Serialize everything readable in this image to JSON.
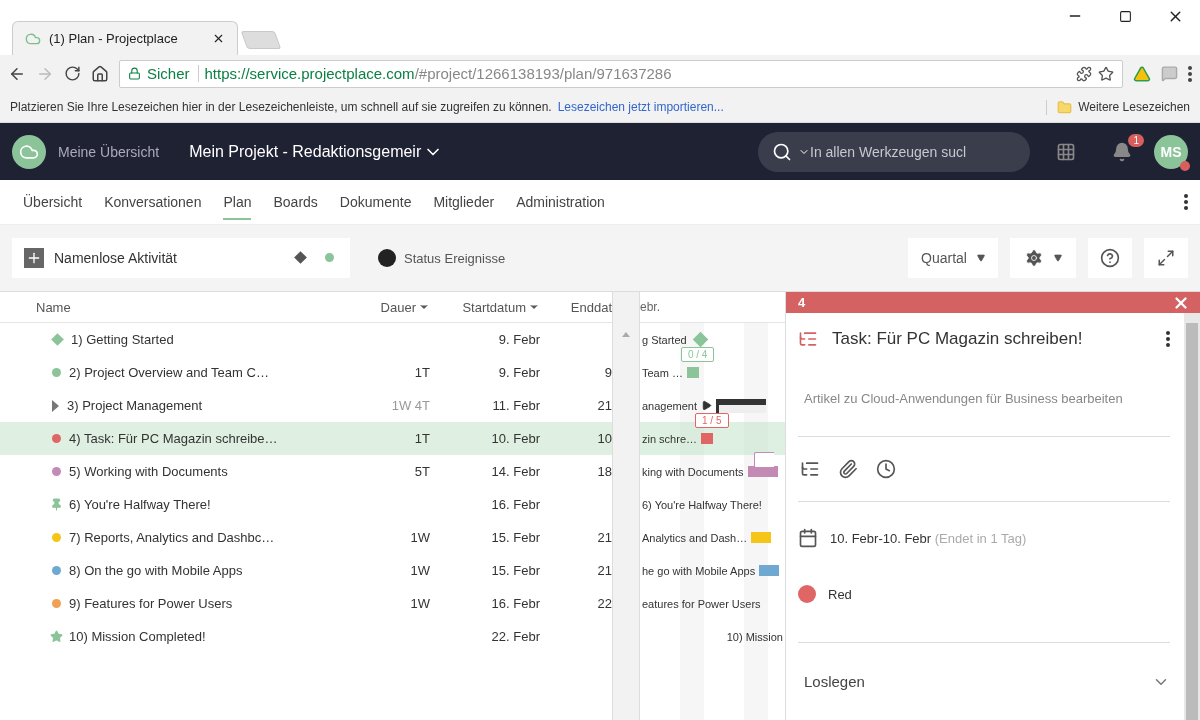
{
  "browser": {
    "tab_title": "(1) Plan - Projectplace",
    "secure_label": "Sicher",
    "url_host": "https://service.projectplace.com",
    "url_path": "/#project/1266138193/plan/971637286",
    "bookmarks_hint": "Platzieren Sie Ihre Lesezeichen hier in der Lesezeichenleiste, um schnell auf sie zugreifen zu können.",
    "bookmarks_link": "Lesezeichen jetzt importieren...",
    "bookmarks_folder": "Weitere Lesezeichen"
  },
  "header": {
    "home_label": "Meine Übersicht",
    "project": "Mein Projekt - Redaktionsgemeir",
    "search": {
      "placeholder": "In allen Werkzeugen sucl"
    },
    "notifications": "1",
    "avatar": "MS"
  },
  "nav_tabs": [
    {
      "label": "Übersicht",
      "selected": false
    },
    {
      "label": "Konversationen",
      "selected": false
    },
    {
      "label": "Plan",
      "selected": true
    },
    {
      "label": "Boards",
      "selected": false
    },
    {
      "label": "Dokumente",
      "selected": false
    },
    {
      "label": "Mitglieder",
      "selected": false
    },
    {
      "label": "Administration",
      "selected": false
    }
  ],
  "toolbar": {
    "new_activity": {
      "placeholder": "Namenlose Aktivität"
    },
    "status_label": "Status Ereignisse",
    "period": "Quartal"
  },
  "table": {
    "columns": [
      "Name",
      "Dauer",
      "Startdatum",
      "Enddat"
    ],
    "rows": [
      {
        "kind": "milestone",
        "color": "#8cc49a",
        "name": "1)  Getting Started",
        "duration": "",
        "start": "9. Febr",
        "end": "",
        "selected": false
      },
      {
        "kind": "task",
        "color": "#8cc49a",
        "name": "2)  Project Overview and Team C…",
        "duration": "1T",
        "start": "9. Febr",
        "end": "9",
        "selected": false
      },
      {
        "kind": "group",
        "color": "#777777",
        "name": "3)  Project Management",
        "duration": "1W 4T",
        "start": "11. Febr",
        "end": "21",
        "selected": false
      },
      {
        "kind": "task",
        "color": "#e06666",
        "name": "4)  Task: Für PC Magazin schreibe…",
        "duration": "1T",
        "start": "10. Febr",
        "end": "10",
        "selected": true
      },
      {
        "kind": "task",
        "color": "#c38ab5",
        "name": "5)  Working with Documents",
        "duration": "5T",
        "start": "14. Febr",
        "end": "18",
        "selected": false
      },
      {
        "kind": "pin",
        "color": "#8cc49a",
        "name": "6)  You're Halfway There!",
        "duration": "",
        "start": "16. Febr",
        "end": "",
        "selected": false
      },
      {
        "kind": "task",
        "color": "#f5c518",
        "name": "7)  Reports, Analytics and Dashbc…",
        "duration": "1W",
        "start": "15. Febr",
        "end": "21",
        "selected": false
      },
      {
        "kind": "task",
        "color": "#6fa8d0",
        "name": "8)  On the go with Mobile Apps",
        "duration": "1W",
        "start": "15. Febr",
        "end": "21",
        "selected": false
      },
      {
        "kind": "task",
        "color": "#f0a050",
        "name": "9)  Features for Power Users",
        "duration": "1W",
        "start": "16. Febr",
        "end": "22",
        "selected": false
      },
      {
        "kind": "star",
        "color": "#8cc49a",
        "name": "10)  Mission Completed!",
        "duration": "",
        "start": "22. Febr",
        "end": "",
        "selected": false
      }
    ]
  },
  "gantt": {
    "header": "ebr.",
    "rows": [
      {
        "label": "g Started",
        "kind": "diamond"
      },
      {
        "label": "Team …",
        "kind": "task",
        "badge": "0 / 4"
      },
      {
        "label": "anagement",
        "kind": "summary"
      },
      {
        "label": "zin schre…",
        "kind": "task",
        "badge": "1 / 5"
      },
      {
        "label": "king with Documents",
        "kind": "task",
        "badge_cut": true
      },
      {
        "label": "6) You're Halfway There!",
        "kind": "none"
      },
      {
        "label": "Analytics and Dash…",
        "kind": "task"
      },
      {
        "label": "he go with Mobile Apps",
        "kind": "task"
      },
      {
        "label": "eatures for Power Users",
        "kind": "none"
      },
      {
        "label": "10) Mission",
        "kind": "none"
      }
    ]
  },
  "detail": {
    "number": "4",
    "title": "Task: Für PC Magazin schreiben!",
    "description": "Artikel zu Cloud-Anwendungen für Business bearbeiten",
    "dates": "10. Febr-10. Febr",
    "dates_note": "(Endet in 1 Tag)",
    "status": {
      "color": "#e06666",
      "label": "Red"
    },
    "section": "Loslegen"
  }
}
